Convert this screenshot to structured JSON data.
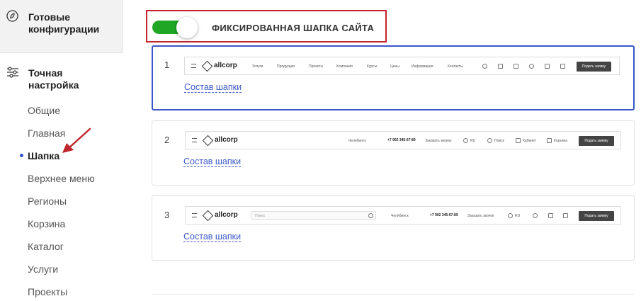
{
  "sidebar": {
    "top_title": "Готовые конфигурации",
    "section_title": "Точная настройка",
    "items": [
      {
        "label": "Общие",
        "active": false
      },
      {
        "label": "Главная",
        "active": false
      },
      {
        "label": "Шапка",
        "active": true
      },
      {
        "label": "Верхнее меню",
        "active": false
      },
      {
        "label": "Регионы",
        "active": false
      },
      {
        "label": "Корзина",
        "active": false
      },
      {
        "label": "Каталог",
        "active": false
      },
      {
        "label": "Услуги",
        "active": false
      },
      {
        "label": "Проекты",
        "active": false
      }
    ]
  },
  "toggle": {
    "label": "ФИКСИРОВАННАЯ ШАПКА САЙТА",
    "on": true,
    "color": "#1ea624"
  },
  "cards": [
    {
      "number": "1",
      "link": "Состав шапки",
      "selected": true,
      "preview": {
        "logo": "allcorp",
        "menu": [
          "Услуги",
          "Продукция",
          "Проекты",
          "Компания",
          "Курсы",
          "Цены",
          "Информация",
          "Контакты"
        ],
        "button": "Подать заявку"
      }
    },
    {
      "number": "2",
      "link": "Состав шапки",
      "selected": false,
      "preview": {
        "logo": "allcorp",
        "region": "Челябинск",
        "phone": "+7 902 345-67-89",
        "callback": "Заказать звонок",
        "lang": "RU",
        "search": "Поиск",
        "cabinet": "Кабинет",
        "cart": "Корзина",
        "button": "Подать заявку"
      }
    },
    {
      "number": "3",
      "link": "Состав шапки",
      "selected": false,
      "preview": {
        "logo": "allcorp",
        "search_placeholder": "Поиск",
        "region": "Челябинск",
        "phone": "+7 902 345-67-89",
        "callback": "Заказать звонок",
        "lang": "RU",
        "button": "Подать заявку"
      }
    }
  ],
  "colors": {
    "accent": "#3a57c8",
    "highlight": "#c4232b",
    "arrow": "#c0262e"
  }
}
